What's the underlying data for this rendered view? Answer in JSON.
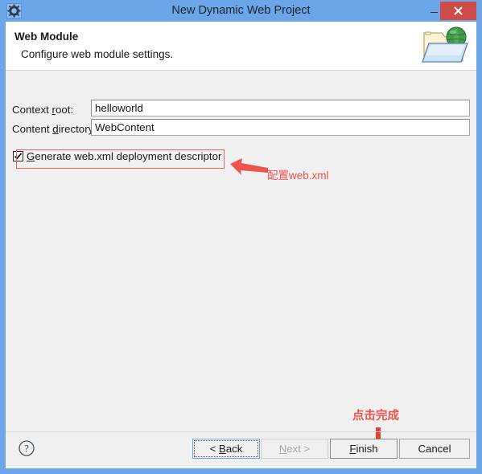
{
  "window": {
    "title": "New Dynamic Web Project",
    "icon": "gear-icon",
    "controls": {
      "minimize": "minimize-icon",
      "maximize": "maximize-icon",
      "close": "close-icon"
    },
    "titlebar_color": "#6aa6e8",
    "close_button_color": "#cf4b48",
    "client_background": "#f0f0f0"
  },
  "header": {
    "title": "Web Module",
    "description": "Configure web module settings.",
    "icon": "web-project-folder-globe-icon"
  },
  "form": {
    "fields": [
      {
        "label_before": "Context ",
        "label_mnemonic": "r",
        "label_after": "oot:",
        "label_full": "Context root:",
        "value": "helloworld",
        "placeholder": ""
      },
      {
        "label_before": "Content ",
        "label_mnemonic": "d",
        "label_after": "irectory:",
        "label_full": "Content directory:",
        "value": "WebContent",
        "placeholder": ""
      }
    ],
    "checkbox": {
      "label_mnemonic": "G",
      "label_after": "enerate web.xml deployment descriptor",
      "label_full": "Generate web.xml deployment descriptor",
      "checked": true
    }
  },
  "annotations": {
    "color": "#f0524d",
    "items": [
      {
        "text": "配置web.xml",
        "arrow": "arrow-left-icon",
        "target": "generate-webxml-checkbox"
      },
      {
        "text": "点击完成",
        "arrow": "arrow-down-icon",
        "target": "finish-button"
      }
    ]
  },
  "footer": {
    "help_icon": "help-question-icon",
    "buttons": [
      {
        "name": "back",
        "label": "< Back",
        "label_before": "< ",
        "label_mnemonic": "B",
        "label_after": "ack",
        "enabled": true,
        "focused": true,
        "default": false
      },
      {
        "name": "next",
        "label": "Next >",
        "label_before": "",
        "label_mnemonic": "N",
        "label_after": "ext >",
        "enabled": false,
        "focused": false,
        "default": false
      },
      {
        "name": "finish",
        "label": "Finish",
        "label_before": "",
        "label_mnemonic": "F",
        "label_after": "inish",
        "enabled": true,
        "focused": false,
        "default": true
      },
      {
        "name": "cancel",
        "label": "Cancel",
        "label_before": "",
        "label_mnemonic": "",
        "label_after": "Cancel",
        "enabled": true,
        "focused": false,
        "default": false
      }
    ]
  }
}
